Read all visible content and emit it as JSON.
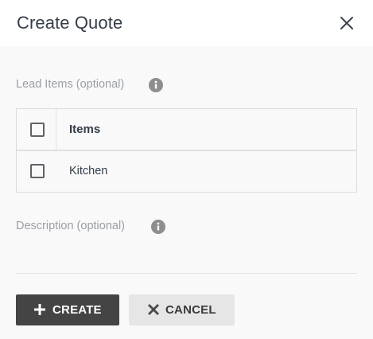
{
  "dialog": {
    "title": "Create Quote",
    "close_icon": "close-icon"
  },
  "lead_items": {
    "label": "Lead Items (optional)",
    "info_icon": "info-icon",
    "table": {
      "header": "Items",
      "rows": [
        {
          "label": "Kitchen",
          "checked": false
        }
      ],
      "select_all_checked": false
    }
  },
  "description": {
    "label": "Description (optional)",
    "info_icon": "info-icon"
  },
  "actions": {
    "create_label": "CREATE",
    "create_icon": "plus-icon",
    "cancel_label": "CANCEL",
    "cancel_icon": "x-icon"
  },
  "colors": {
    "primary_button": "#444444",
    "secondary_button": "#e6e6e6",
    "label_gray": "#9a9fa5",
    "text_dark": "#333d4a"
  }
}
